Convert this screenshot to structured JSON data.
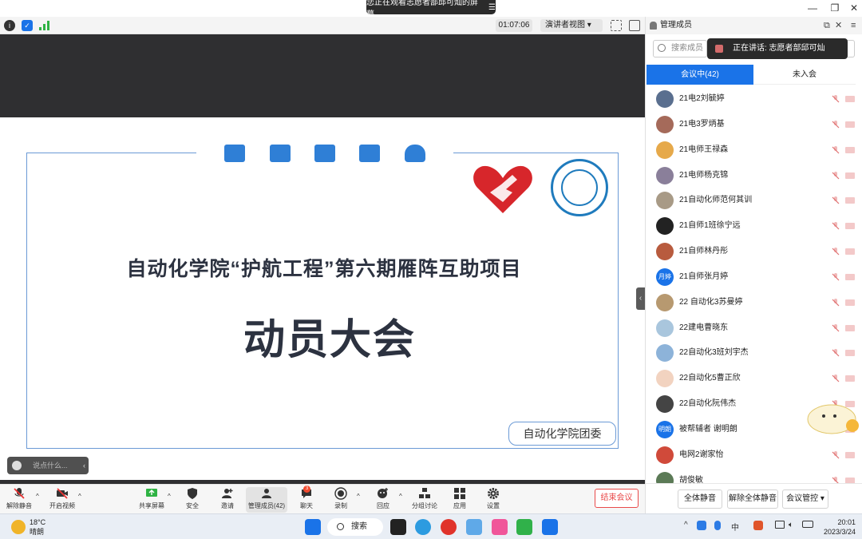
{
  "window": {
    "share_banner": "您正在观看志愿者部邱可灿的屏幕",
    "banner_menu_icon": "menu-lines-icon",
    "minimize": "—",
    "maximize": "❐",
    "close": "✕"
  },
  "status_bar": {
    "info_icon": "info-icon",
    "shield_icon": "shield-icon",
    "signal_icon": "signal-icon",
    "timer": "01:07:06",
    "view_mode": "演讲者视图",
    "view_dropdown": "▾"
  },
  "slide": {
    "title_line1": "自动化学院“护航工程”第六期雁阵互助项目",
    "title_line2": "动员大会",
    "organizer": "自动化学院团委",
    "icon_names": [
      "list-icon",
      "network-icon",
      "image-icon",
      "message-icon",
      "cloud-download-icon"
    ],
    "accent_color": "#2f7fd6"
  },
  "chat_input": {
    "placeholder": "说点什么...",
    "collapse": "‹"
  },
  "toolbar": {
    "unmute": "解除静音",
    "start_video": "开启视频",
    "share_screen": "共享屏幕",
    "security": "安全",
    "invite": "邀请",
    "manage_members": "管理成员(42)",
    "chat": "聊天",
    "chat_badge": "3",
    "record": "录制",
    "reactions": "回应",
    "breakout": "分组讨论",
    "apps": "应用",
    "settings": "设置",
    "end_meeting": "结束会议",
    "caret": "^"
  },
  "panel": {
    "title": "管理成员",
    "search_placeholder": "搜索成员",
    "speaking": "正在讲话: 志愿者部邱可灿",
    "tab_in_meeting": "会议中(42)",
    "tab_not_joined": "未入会",
    "participants": [
      {
        "name": "21电2刘毓婷",
        "avatar_text": "",
        "avatar_color": "#5a6f8f"
      },
      {
        "name": "21电3罗炳基",
        "avatar_text": "",
        "avatar_color": "#a56a5a"
      },
      {
        "name": "21电师王禄森",
        "avatar_text": "",
        "avatar_color": "#e6a94a"
      },
      {
        "name": "21电师杨克锦",
        "avatar_text": "",
        "avatar_color": "#8a7f9a"
      },
      {
        "name": "21自动化师范何其训",
        "avatar_text": "",
        "avatar_color": "#a89a86"
      },
      {
        "name": "21自师1班徐宁远",
        "avatar_text": "",
        "avatar_color": "#222222"
      },
      {
        "name": "21自师林丹彤",
        "avatar_text": "",
        "avatar_color": "#b85b3e"
      },
      {
        "name": "21自师张月婷",
        "avatar_text": "月婷",
        "avatar_color": "#1a73e8"
      },
      {
        "name": "22 自动化3苏曼婷",
        "avatar_text": "",
        "avatar_color": "#b79970"
      },
      {
        "name": "22建电曹晓东",
        "avatar_text": "",
        "avatar_color": "#a9c6dd"
      },
      {
        "name": "22自动化3班刘宇杰",
        "avatar_text": "",
        "avatar_color": "#8db3d9"
      },
      {
        "name": "22自动化5曹正欣",
        "avatar_text": "",
        "avatar_color": "#f2d3c0"
      },
      {
        "name": "22自动化阮伟杰",
        "avatar_text": "",
        "avatar_color": "#444444"
      },
      {
        "name": "被帮辅者 谢明朗",
        "avatar_text": "明朗",
        "avatar_color": "#1a73e8"
      },
      {
        "name": "电网2谢家怡",
        "avatar_text": "",
        "avatar_color": "#d04a3a"
      },
      {
        "name": "胡俊敏",
        "avatar_text": "",
        "avatar_color": "#5b7a56"
      }
    ],
    "mute_all": "全体静音",
    "unmute_all": "解除全体静音",
    "meeting_control": "会议管控"
  },
  "taskbar": {
    "temperature": "18°C",
    "weather": "晴朗",
    "search": "搜索",
    "time": "20:01",
    "date": "2023/3/24",
    "input_method": "中",
    "tray_caret": "^"
  }
}
